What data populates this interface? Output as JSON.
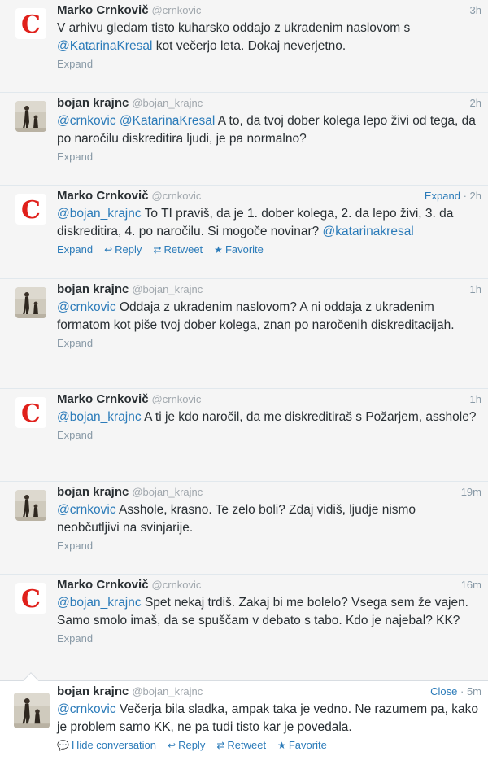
{
  "tweets": [
    {
      "name": "Marko Crnkovič",
      "handle": "@crnkovic",
      "time": "3h",
      "header_link": "",
      "avatar": "c-logo",
      "parts": [
        {
          "t": "V arhivu gledam tisto kuharsko oddajo z ukradenim naslovom s ",
          "m": false
        },
        {
          "t": "@KatarinaKresal",
          "m": true
        },
        {
          "t": " kot večerjo leta. Dokaj neverjetno.",
          "m": false
        }
      ],
      "footer": "expand",
      "expand": "Expand"
    },
    {
      "name": "bojan krajnc",
      "handle": "@bojan_krajnc",
      "time": "2h",
      "header_link": "",
      "avatar": "photo",
      "parts": [
        {
          "t": "@crnkovic",
          "m": true
        },
        {
          "t": " ",
          "m": false
        },
        {
          "t": "@KatarinaKresal",
          "m": true
        },
        {
          "t": " A to, da tvoj dober kolega lepo živi od tega, da po naročilu diskreditira ljudi, je pa normalno?",
          "m": false
        }
      ],
      "footer": "expand",
      "expand": "Expand"
    },
    {
      "name": "Marko Crnkovič",
      "handle": "@crnkovic",
      "time": "2h",
      "header_link": "Expand",
      "avatar": "c-logo",
      "parts": [
        {
          "t": "@bojan_krajnc",
          "m": true
        },
        {
          "t": " To TI praviš, da je 1. dober kolega, 2. da lepo živi, 3. da diskreditira, 4. po naročilu. Si mogoče novinar? ",
          "m": false
        },
        {
          "t": "@katarinakresal",
          "m": true
        }
      ],
      "footer": "actions",
      "actions": {
        "expand": "Expand",
        "reply": "Reply",
        "retweet": "Retweet",
        "favorite": "Favorite"
      }
    },
    {
      "name": "bojan krajnc",
      "handle": "@bojan_krajnc",
      "time": "1h",
      "header_link": "",
      "avatar": "photo",
      "parts": [
        {
          "t": "@crnkovic",
          "m": true
        },
        {
          "t": " Oddaja z ukradenim naslovom? A ni oddaja z ukradenim formatom kot piše tvoj dober kolega, znan po naročenih diskreditacijah.",
          "m": false
        }
      ],
      "footer": "expand",
      "expand": "Expand"
    },
    {
      "name": "Marko Crnkovič",
      "handle": "@crnkovic",
      "time": "1h",
      "header_link": "",
      "avatar": "c-logo",
      "parts": [
        {
          "t": "@bojan_krajnc",
          "m": true
        },
        {
          "t": " A ti je kdo naročil, da me diskreditiraš s Požarjem, asshole?",
          "m": false
        }
      ],
      "footer": "expand",
      "expand": "Expand"
    },
    {
      "name": "bojan krajnc",
      "handle": "@bojan_krajnc",
      "time": "19m",
      "header_link": "",
      "avatar": "photo",
      "parts": [
        {
          "t": "@crnkovic",
          "m": true
        },
        {
          "t": " Asshole, krasno. Te zelo boli? Zdaj vidiš, ljudje nismo neobčutljivi na svinjarije.",
          "m": false
        }
      ],
      "footer": "expand",
      "expand": "Expand"
    },
    {
      "name": "Marko Crnkovič",
      "handle": "@crnkovic",
      "time": "16m",
      "header_link": "",
      "avatar": "c-logo",
      "parts": [
        {
          "t": "@bojan_krajnc",
          "m": true
        },
        {
          "t": " Spet nekaj trdiš. Zakaj bi me bolelo? Vsega sem že vajen. Samo smolo imaš, da se spuščam v debato s tabo. Kdo je najebal? KK?",
          "m": false
        }
      ],
      "footer": "expand",
      "expand": "Expand"
    },
    {
      "name": "bojan krajnc",
      "handle": "@bojan_krajnc",
      "time": "5m",
      "header_link": "Close",
      "avatar": "photo",
      "parts": [
        {
          "t": "@crnkovic",
          "m": true
        },
        {
          "t": " Večerja bila sladka, ampak taka je vedno. Ne razumem pa, kako je problem samo KK, ne pa tudi tisto kar je povedala.",
          "m": false
        }
      ],
      "footer": "actions",
      "actions": {
        "expand": "Hide conversation",
        "reply": "Reply",
        "retweet": "Retweet",
        "favorite": "Favorite"
      }
    }
  ],
  "colors": {
    "link": "#2b7bb9",
    "logo_red": "#e0201b",
    "muted": "#8899a6"
  }
}
